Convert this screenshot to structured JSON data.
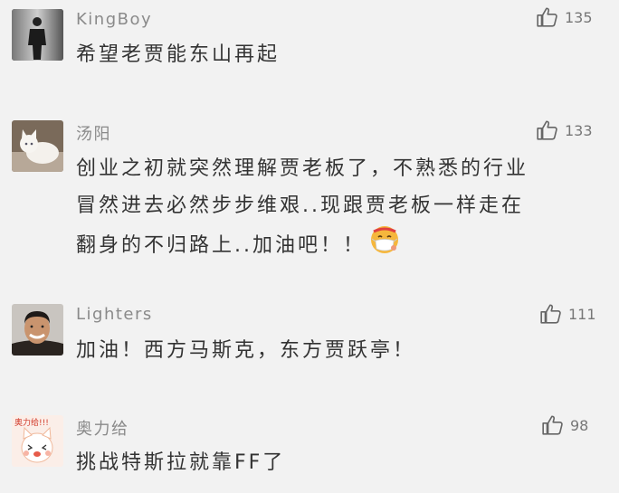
{
  "comments": [
    {
      "username": "KingBoy",
      "likes": "135",
      "text": "希望老贾能东山再起",
      "avatar_icon": "man-in-suit-photo"
    },
    {
      "username": "汤阳",
      "likes": "133",
      "text_lines": [
        "创业之初就突然理解贾老板了，不熟悉的行业",
        "冒然进去必然步步维艰..现跟贾老板一样走在",
        "翻身的不归路上..加油吧！！"
      ],
      "emoji_icon": "face-with-medical-mask-emoji",
      "avatar_icon": "white-cat-photo"
    },
    {
      "username": "Lighters",
      "likes": "111",
      "text": "加油！西方马斯克，东方贾跃亭！",
      "avatar_icon": "smiling-man-photo"
    },
    {
      "username": "奥力给",
      "likes": "98",
      "text": "挑战特斯拉就靠FF了",
      "avatar_icon": "cartoon-cat-sticker",
      "avatar_sticker_text": "奥力给!!!"
    }
  ],
  "colors": {
    "background": "#f2f2f2",
    "username": "#8a8a8a",
    "body_text": "#333333",
    "like_icon": "#666666"
  }
}
